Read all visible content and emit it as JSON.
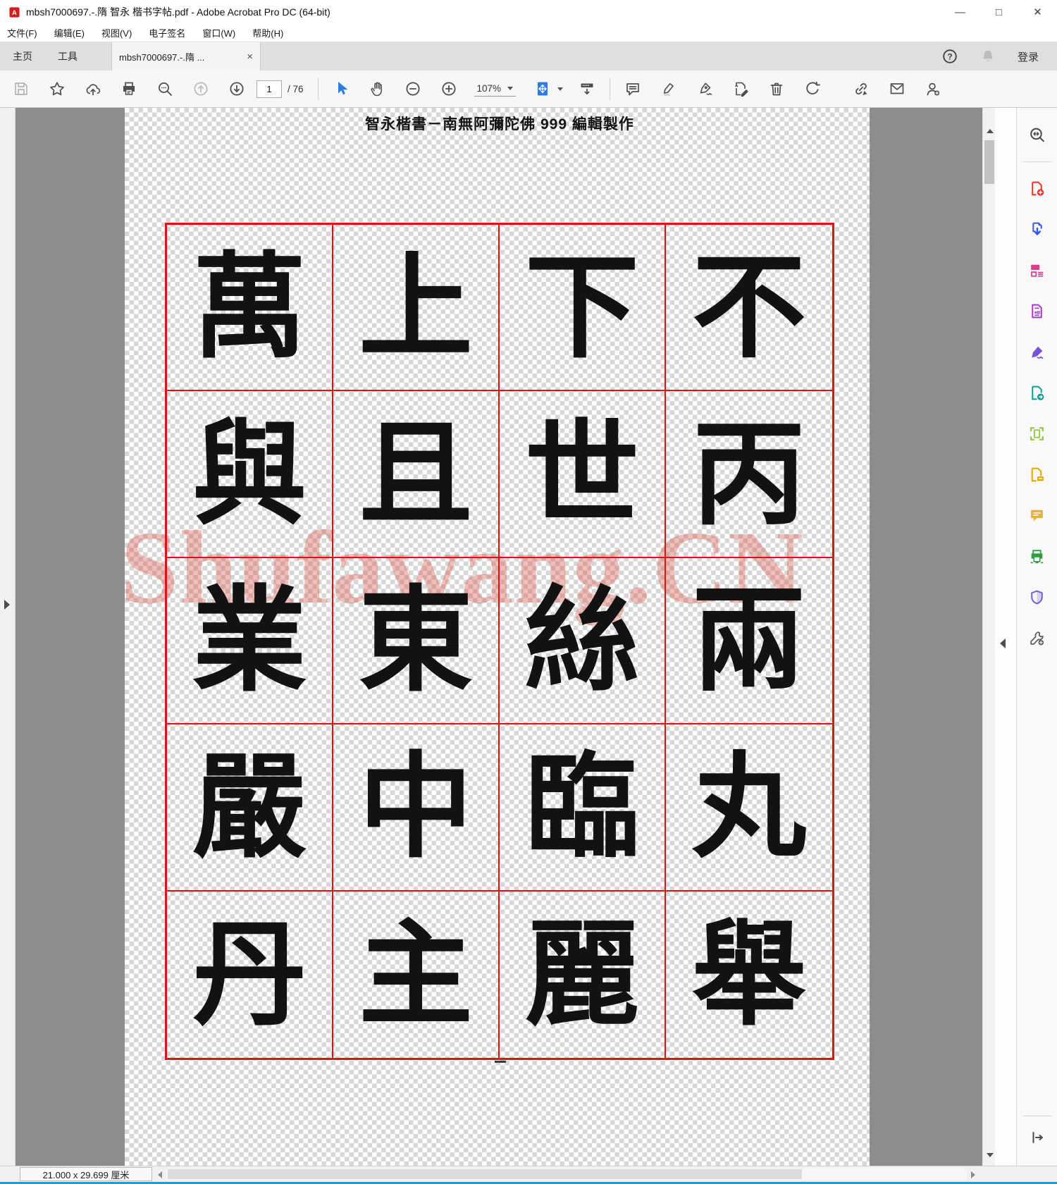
{
  "window": {
    "title": "mbsh7000697.-.隋 智永 楷书字帖.pdf - Adobe Acrobat Pro DC (64-bit)",
    "minimize_glyph": "—",
    "maximize_glyph": "□",
    "close_glyph": "✕"
  },
  "menubar": {
    "items": [
      "文件(F)",
      "编辑(E)",
      "视图(V)",
      "电子签名",
      "窗口(W)",
      "帮助(H)"
    ]
  },
  "tabbar": {
    "home_label": "主页",
    "tools_label": "工具",
    "document_tab_label": "mbsh7000697.-.隋 ...",
    "tab_close_glyph": "×",
    "sign_in_label": "登录"
  },
  "toolbar": {
    "page_current": "1",
    "page_total_label": "/ 76",
    "zoom_value": "107%"
  },
  "page": {
    "header_title": "智永楷書－南無阿彌陀佛 999 編輯製作",
    "watermark_text": "Shufawang.CN",
    "grid_rows": [
      [
        "萬",
        "上",
        "下",
        "不"
      ],
      [
        "與",
        "且",
        "世",
        "丙"
      ],
      [
        "業",
        "東",
        "絲",
        "兩"
      ],
      [
        "嚴",
        "中",
        "臨",
        "丸"
      ],
      [
        "丹",
        "主",
        "麗",
        "舉"
      ]
    ]
  },
  "statusbar": {
    "page_dimensions": "21.000 x 29.699 厘米"
  },
  "sidebar": {
    "tool_icons": [
      "search-tools",
      "create-pdf",
      "export-pdf",
      "organize-pages",
      "convert-document",
      "fill-and-sign",
      "send-for-signature",
      "crop-pages",
      "compress-pdf",
      "comment",
      "scan-and-ocr",
      "protect-pdf",
      "more-tools"
    ]
  },
  "colors": {
    "grid_border": "#e31212",
    "watermark": "rgba(219,88,74,0.38)",
    "canvas_gray": "#8d8d8d",
    "accent_blue": "#2e7ce0",
    "acrobat_red": "#e4342b",
    "export_blue": "#3b57e8",
    "organize_pink": "#db3d8d",
    "convert_purple": "#a33bc4",
    "fillsign_purple": "#7a52d9",
    "send_teal": "#0f9d8f",
    "crop_green": "#93c83d",
    "compress_yellow": "#d7a90f",
    "comment_yellow": "#e3b23c",
    "scan_green": "#2f9e44",
    "protect_purple": "#6b5ce7",
    "window_accent": "#1b9ddb"
  }
}
